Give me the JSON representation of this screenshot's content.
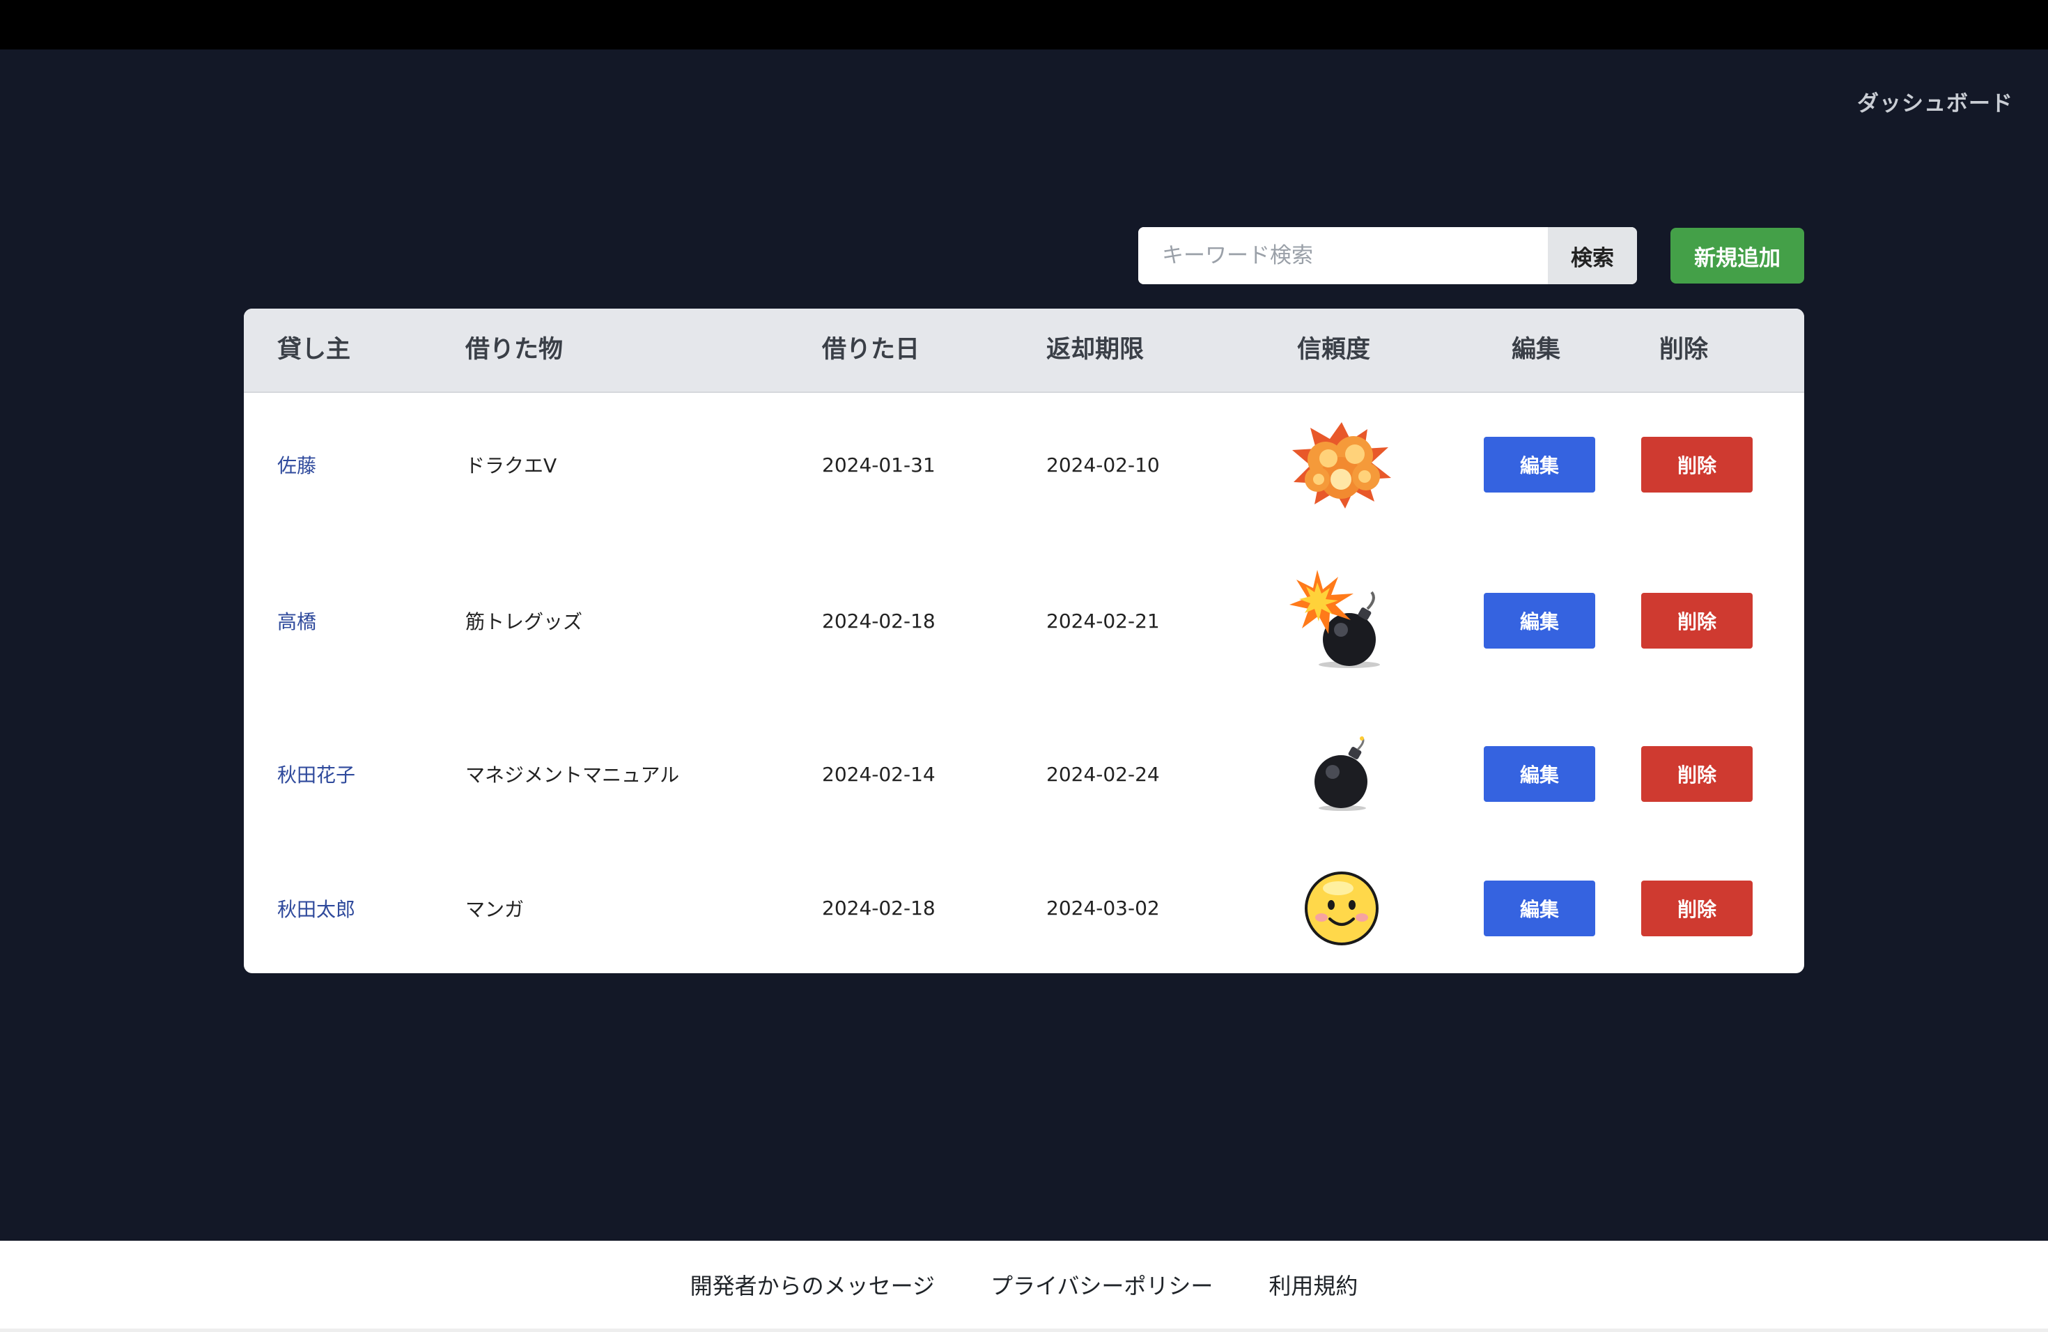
{
  "header": {
    "dashboard_label": "ダッシュボード"
  },
  "search": {
    "placeholder": "キーワード検索",
    "value": "",
    "button_label": "検索"
  },
  "add_button_label": "新規追加",
  "table": {
    "columns": [
      "貸し主",
      "借りた物",
      "借りた日",
      "返却期限",
      "信頼度",
      "編集",
      "削除"
    ],
    "rows": [
      {
        "lender": "佐藤",
        "item": "ドラクエV",
        "borrowed": "2024-01-31",
        "due": "2024-02-10",
        "trust_icon": "explosion-icon",
        "edit": "編集",
        "delete": "削除"
      },
      {
        "lender": "高橋",
        "item": "筋トレグッズ",
        "borrowed": "2024-02-18",
        "due": "2024-02-21",
        "trust_icon": "lit-bomb-icon",
        "edit": "編集",
        "delete": "削除"
      },
      {
        "lender": "秋田花子",
        "item": "マネジメントマニュアル",
        "borrowed": "2024-02-14",
        "due": "2024-02-24",
        "trust_icon": "bomb-icon",
        "edit": "編集",
        "delete": "削除"
      },
      {
        "lender": "秋田太郎",
        "item": "マンガ",
        "borrowed": "2024-02-18",
        "due": "2024-03-02",
        "trust_icon": "smiley-icon",
        "edit": "編集",
        "delete": "削除"
      }
    ]
  },
  "footer": {
    "links": [
      "開発者からのメッセージ",
      "プライバシーポリシー",
      "利用規約"
    ]
  },
  "colors": {
    "background": "#131827",
    "edit_button": "#3563e0",
    "delete_button": "#cf3a30",
    "add_button": "#44a048",
    "lender_link": "#2f4a9c"
  }
}
